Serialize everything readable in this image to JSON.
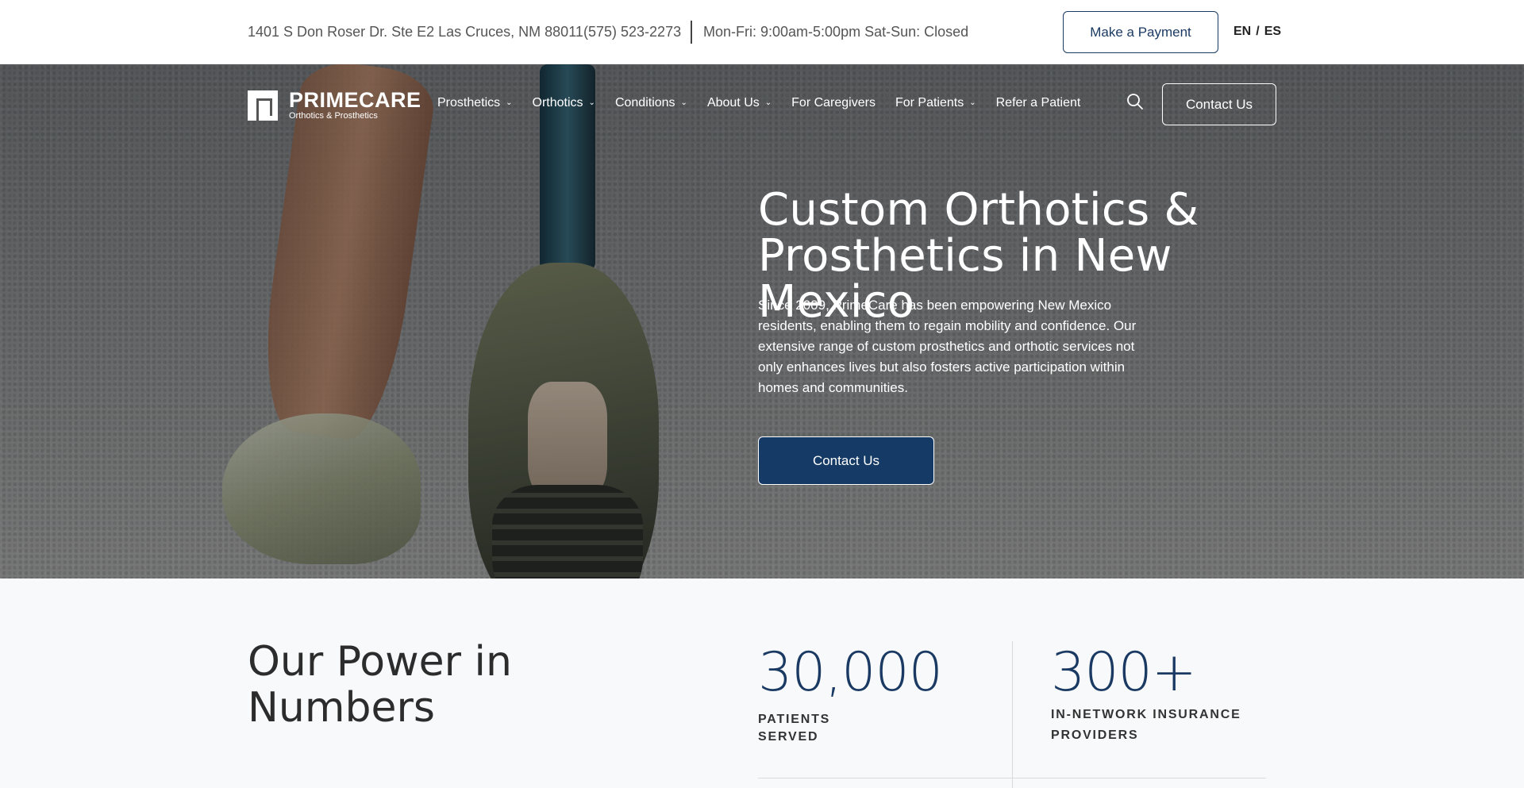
{
  "topbar": {
    "address": "1401 S Don Roser Dr. Ste E2 Las Cruces, NM 88011",
    "phone": "(575) 523-2273",
    "hours": "Mon-Fri: 9:00am-5:00pm  Sat-Sun: Closed",
    "payment_button": "Make a Payment",
    "lang_en": "EN",
    "lang_sep": "/",
    "lang_es": "ES"
  },
  "logo": {
    "brand": "PRIMECARE",
    "tagline": "Orthotics & Prosthetics"
  },
  "nav": {
    "items": [
      {
        "label": "Prosthetics",
        "has_dropdown": true
      },
      {
        "label": "Orthotics",
        "has_dropdown": true
      },
      {
        "label": "Conditions",
        "has_dropdown": true
      },
      {
        "label": "About Us",
        "has_dropdown": true
      },
      {
        "label": "For Caregivers",
        "has_dropdown": false
      },
      {
        "label": "For Patients",
        "has_dropdown": true
      },
      {
        "label": "Refer a Patient",
        "has_dropdown": false
      }
    ],
    "contact_button": "Contact Us"
  },
  "hero": {
    "title": "Custom Orthotics & Prosthetics in New Mexico",
    "description": "Since 2009, PrimeCare has been empowering New Mexico residents, enabling them to regain mobility and confidence. Our extensive range of custom prosthetics and orthotic services not only enhances lives but also fosters active participation within homes and communities.",
    "cta": "Contact Us"
  },
  "numbers": {
    "title": "Our Power in Numbers",
    "stats": [
      {
        "value": "30,000",
        "label": "PATIENTS SERVED"
      },
      {
        "value": "300+",
        "label": "IN-NETWORK INSURANCE PROVIDERS"
      }
    ]
  },
  "colors": {
    "brand_navy": "#153a66",
    "text_dark": "#2c2c2c"
  },
  "icons": {
    "search": "search-icon",
    "chevron": "chevron-down-icon"
  }
}
